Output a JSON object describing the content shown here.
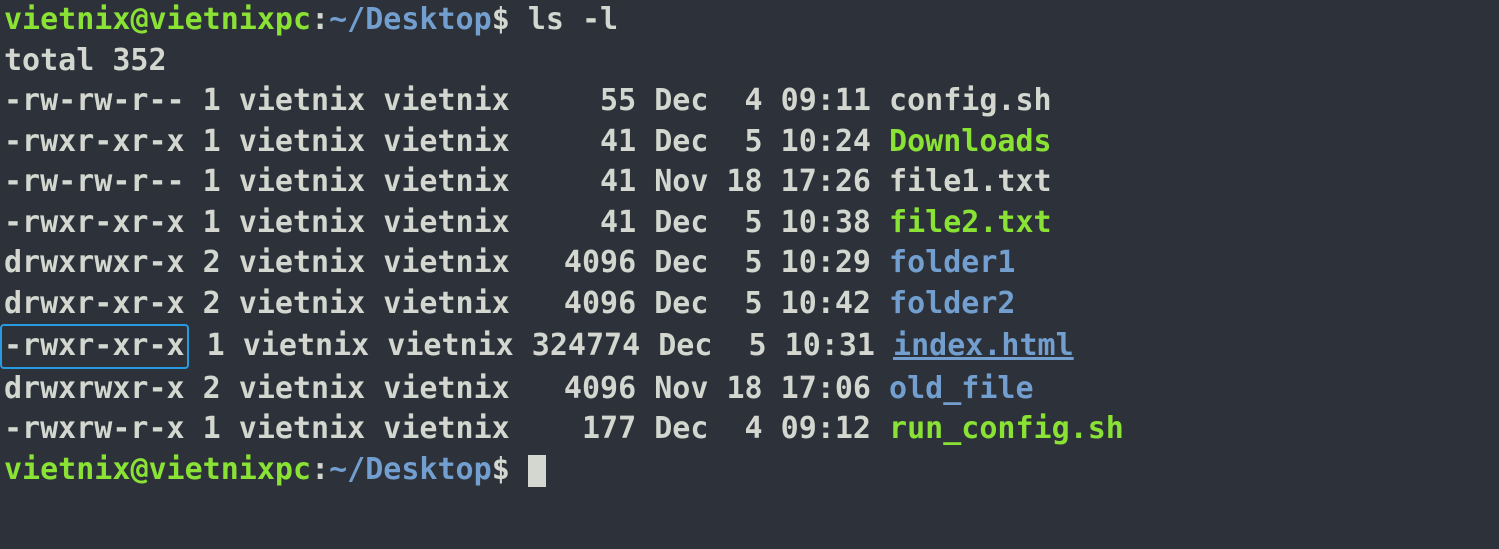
{
  "prompt1": {
    "user": "vietnix",
    "host": "vietnixpc",
    "path": "~/Desktop",
    "dollar": "$",
    "command": "ls -l"
  },
  "total_line": "total 352",
  "files": [
    {
      "perm": "-rw-rw-r--",
      "links": "1",
      "owner": "vietnix",
      "group": "vietnix",
      "size": "55",
      "month": "Dec",
      "day": "4",
      "time": "09:11",
      "name": "config.sh",
      "style": "fg",
      "highlight": false,
      "underline": false
    },
    {
      "perm": "-rwxr-xr-x",
      "links": "1",
      "owner": "vietnix",
      "group": "vietnix",
      "size": "41",
      "month": "Dec",
      "day": "5",
      "time": "10:24",
      "name": "Downloads",
      "style": "exec",
      "highlight": false,
      "underline": false
    },
    {
      "perm": "-rw-rw-r--",
      "links": "1",
      "owner": "vietnix",
      "group": "vietnix",
      "size": "41",
      "month": "Nov",
      "day": "18",
      "time": "17:26",
      "name": "file1.txt",
      "style": "fg",
      "highlight": false,
      "underline": false
    },
    {
      "perm": "-rwxr-xr-x",
      "links": "1",
      "owner": "vietnix",
      "group": "vietnix",
      "size": "41",
      "month": "Dec",
      "day": "5",
      "time": "10:38",
      "name": "file2.txt",
      "style": "exec",
      "highlight": false,
      "underline": false
    },
    {
      "perm": "drwxrwxr-x",
      "links": "2",
      "owner": "vietnix",
      "group": "vietnix",
      "size": "4096",
      "month": "Dec",
      "day": "5",
      "time": "10:29",
      "name": "folder1",
      "style": "dir",
      "highlight": false,
      "underline": false
    },
    {
      "perm": "drwxr-xr-x",
      "links": "2",
      "owner": "vietnix",
      "group": "vietnix",
      "size": "4096",
      "month": "Dec",
      "day": "5",
      "time": "10:42",
      "name": "folder2",
      "style": "dir",
      "highlight": false,
      "underline": false
    },
    {
      "perm": "-rwxr-xr-x",
      "links": "1",
      "owner": "vietnix",
      "group": "vietnix",
      "size": "324774",
      "month": "Dec",
      "day": "5",
      "time": "10:31",
      "name": "index.html",
      "style": "dir",
      "highlight": true,
      "underline": true
    },
    {
      "perm": "drwxrwxr-x",
      "links": "2",
      "owner": "vietnix",
      "group": "vietnix",
      "size": "4096",
      "month": "Nov",
      "day": "18",
      "time": "17:06",
      "name": "old_file",
      "style": "dir",
      "highlight": false,
      "underline": false
    },
    {
      "perm": "-rwxrw-r-x",
      "links": "1",
      "owner": "vietnix",
      "group": "vietnix",
      "size": "177",
      "month": "Dec",
      "day": "4",
      "time": "09:12",
      "name": "run_config.sh",
      "style": "exec",
      "highlight": false,
      "underline": false
    }
  ],
  "prompt2": {
    "user": "vietnix",
    "host": "vietnixpc",
    "path": "~/Desktop",
    "dollar": "$"
  },
  "col_widths": {
    "perm": 10,
    "links": 1,
    "owner": 7,
    "group": 7,
    "size": 6,
    "month": 3,
    "day": 2,
    "time": 5
  }
}
